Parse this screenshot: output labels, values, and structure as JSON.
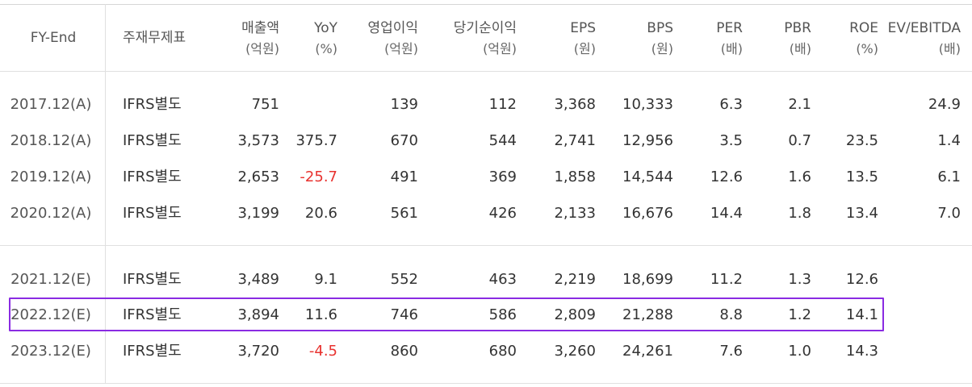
{
  "headers": [
    {
      "l1": "FY-End",
      "l2": ""
    },
    {
      "l1": "주재무제표",
      "l2": ""
    },
    {
      "l1": "매출액",
      "l2": "(억원)"
    },
    {
      "l1": "YoY",
      "l2": "(%)"
    },
    {
      "l1": "영업이익",
      "l2": "(억원)"
    },
    {
      "l1": "당기순이익",
      "l2": "(억원)"
    },
    {
      "l1": "EPS",
      "l2": "(원)"
    },
    {
      "l1": "BPS",
      "l2": "(원)"
    },
    {
      "l1": "PER",
      "l2": "(배)"
    },
    {
      "l1": "PBR",
      "l2": "(배)"
    },
    {
      "l1": "ROE",
      "l2": "(%)"
    },
    {
      "l1": "EV/EBITDA",
      "l2": "(배)"
    }
  ],
  "rows": [
    [
      "2017.12(A)",
      "IFRS별도",
      "751",
      "",
      "139",
      "112",
      "3,368",
      "10,333",
      "6.3",
      "2.1",
      "",
      "24.9"
    ],
    [
      "2018.12(A)",
      "IFRS별도",
      "3,573",
      "375.7",
      "670",
      "544",
      "2,741",
      "12,956",
      "3.5",
      "0.7",
      "23.5",
      "1.4"
    ],
    [
      "2019.12(A)",
      "IFRS별도",
      "2,653",
      "-25.7",
      "491",
      "369",
      "1,858",
      "14,544",
      "12.6",
      "1.6",
      "13.5",
      "6.1"
    ],
    [
      "2020.12(A)",
      "IFRS별도",
      "3,199",
      "20.6",
      "561",
      "426",
      "2,133",
      "16,676",
      "14.4",
      "1.8",
      "13.4",
      "7.0"
    ],
    [
      "2021.12(E)",
      "IFRS별도",
      "3,489",
      "9.1",
      "552",
      "463",
      "2,219",
      "18,699",
      "11.2",
      "1.3",
      "12.6",
      ""
    ],
    [
      "2022.12(E)",
      "IFRS별도",
      "3,894",
      "11.6",
      "746",
      "586",
      "2,809",
      "21,288",
      "8.8",
      "1.2",
      "14.1",
      ""
    ],
    [
      "2023.12(E)",
      "IFRS별도",
      "3,720",
      "-4.5",
      "860",
      "680",
      "3,260",
      "24,261",
      "7.6",
      "1.0",
      "14.3",
      ""
    ]
  ],
  "colors": {
    "negative": "#e8322f",
    "highlight_border": "#8a2be2",
    "divider": "#e0e0e0"
  },
  "highlighted_row": "2022.12(E)"
}
